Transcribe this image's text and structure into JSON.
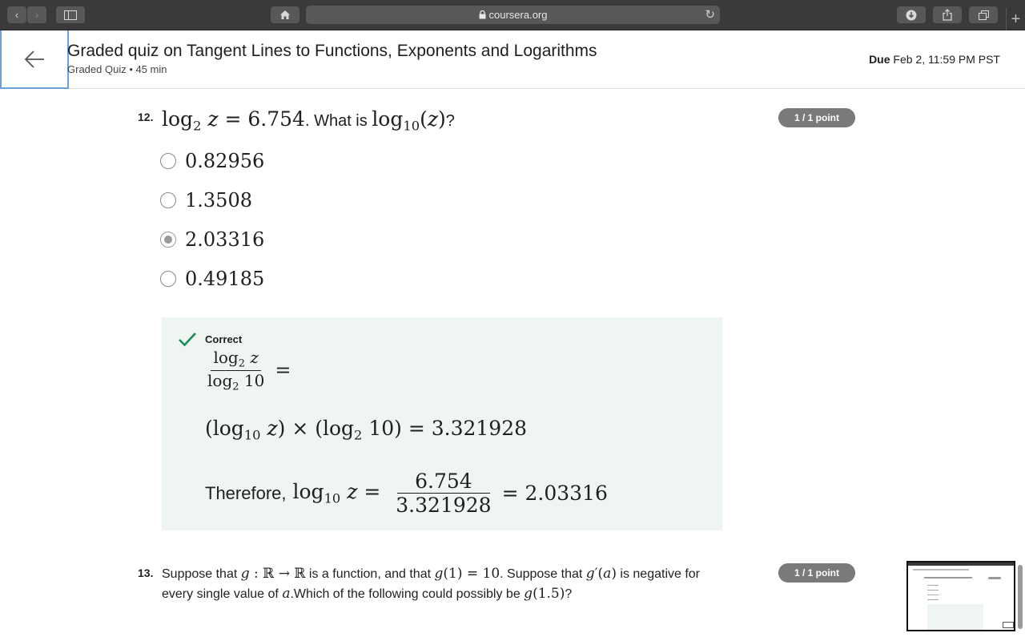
{
  "browser": {
    "url": "coursera.org",
    "back_icon": "chevron-left-icon",
    "forward_icon": "chevron-right-icon",
    "sidebar_icon": "sidebar-icon",
    "home_icon": "home-icon",
    "lock_icon": "lock-icon",
    "reload_icon": "reload-icon",
    "download_icon": "download-icon",
    "share_icon": "share-icon",
    "tabs_icon": "tabs-icon",
    "new_tab_label": "+"
  },
  "header": {
    "title": "Graded quiz on Tangent Lines to Functions, Exponents and Logarithms",
    "subtitle": "Graded Quiz • 45 min",
    "due_label": "Due",
    "due_value": "Feb 2, 11:59 PM PST"
  },
  "q12": {
    "number": "12.",
    "points": "1 / 1 point",
    "prompt_mid": ". What is ",
    "prompt_end": "?",
    "options": [
      "0.82956",
      "1.3508",
      "2.03316",
      "0.49185"
    ],
    "selected_index": 2,
    "feedback": {
      "status": "Correct",
      "lhs_num": "log2 z",
      "lhs_den": "log2 10",
      "eq": "=",
      "line2": "(log10 z) × (log2 10) = 3.321928",
      "therefore": "Therefore,",
      "frac_num": "6.754",
      "frac_den": "3.321928",
      "result": "= 2.03316"
    }
  },
  "q13": {
    "number": "13.",
    "points": "1 / 1 point",
    "t1": "Suppose that ",
    "t2": " is a function, and that ",
    "t3": ". Suppose that ",
    "t4": " is negative for",
    "t5": "every single value of ",
    "t6": ".Which of the following could possibly be ",
    "t7": "?"
  },
  "colors": {
    "chrome": "#3a3a3c",
    "correct_green": "#1b8a5a",
    "feedback_bg": "#eff6f2",
    "points_badge": "#7a7a7a",
    "focus_blue": "#6b9fe0"
  }
}
